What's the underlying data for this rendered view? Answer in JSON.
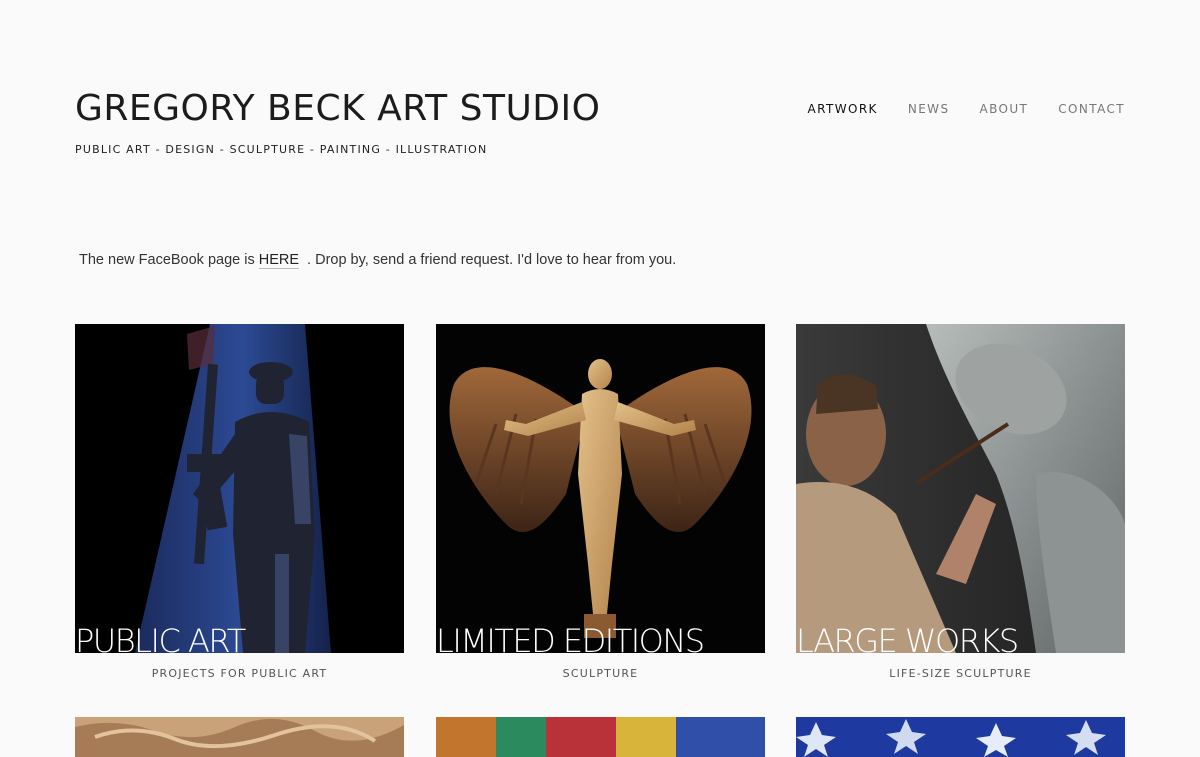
{
  "site": {
    "title": "GREGORY BECK ART STUDIO",
    "tagline": "PUBLIC ART - DESIGN - SCULPTURE - PAINTING - ILLUSTRATION"
  },
  "nav": {
    "items": [
      {
        "label": "ARTWORK",
        "active": true
      },
      {
        "label": "NEWS",
        "active": false
      },
      {
        "label": "ABOUT",
        "active": false
      },
      {
        "label": "CONTACT",
        "active": false
      }
    ]
  },
  "announcement": {
    "before": "The new FaceBook page is ",
    "link": "HERE",
    "after": ". Drop by, send a friend request. I'd love to hear from you."
  },
  "gallery": {
    "tiles": [
      {
        "overlay": "PUBLIC ART",
        "caption": "PROJECTS FOR PUBLIC ART"
      },
      {
        "overlay": "LIMITED EDITIONS",
        "caption": "SCULPTURE"
      },
      {
        "overlay": "LARGE  WORKS",
        "caption": "LIFE-SIZE SCULPTURE"
      }
    ]
  },
  "colors": {
    "background": "#fafafa",
    "text": "#222222",
    "nav_inactive": "#777777"
  }
}
